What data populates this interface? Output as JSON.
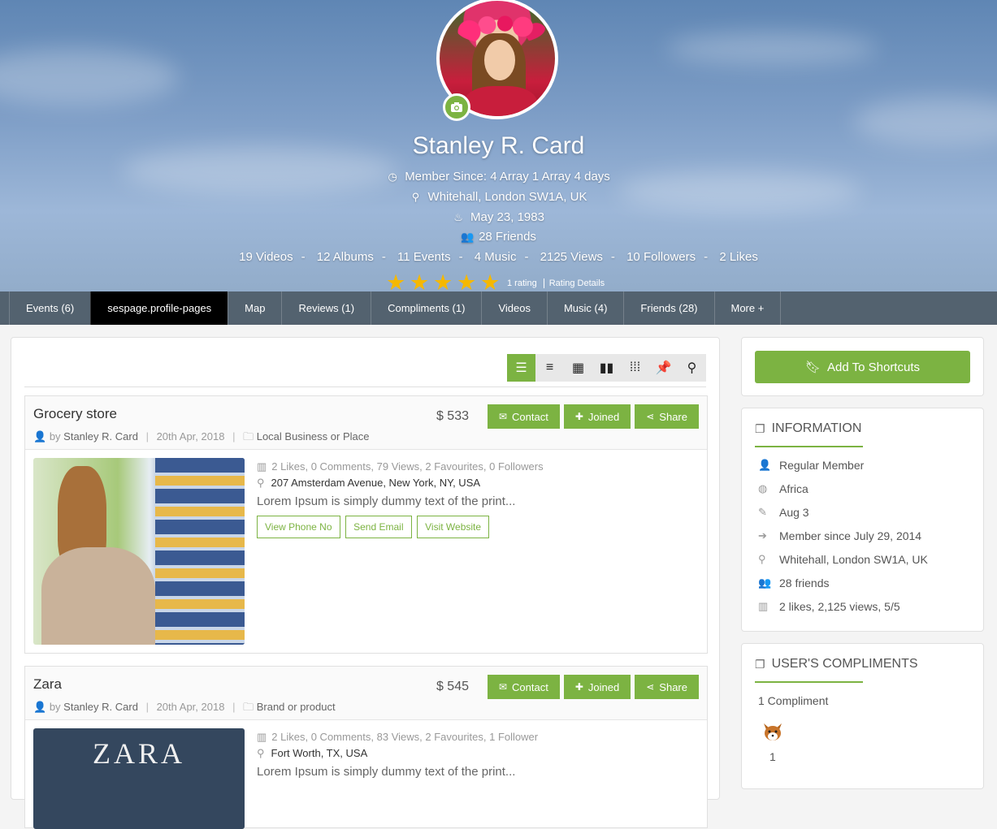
{
  "profile": {
    "name": "Stanley R. Card",
    "member_since": "Member Since: 4 Array 1 Array 4 days",
    "location": "Whitehall, London SW1A, UK",
    "birthday": "May 23, 1983",
    "friends": "28 Friends",
    "stats": [
      "19 Videos",
      "12 Albums",
      "11 Events",
      "4 Music",
      "2125 Views",
      "10 Followers",
      "2 Likes"
    ],
    "stats_separator": "-",
    "rating_value": 5,
    "rating_max": 5,
    "rating_count": "1 rating",
    "rating_details": "Rating Details"
  },
  "tabs": [
    {
      "label": "Events (6)",
      "active": false
    },
    {
      "label": "sespage.profile-pages",
      "active": true
    },
    {
      "label": "Map",
      "active": false
    },
    {
      "label": "Reviews (1)",
      "active": false
    },
    {
      "label": "Compliments (1)",
      "active": false
    },
    {
      "label": "Videos",
      "active": false
    },
    {
      "label": "Music (4)",
      "active": false
    },
    {
      "label": "Friends (28)",
      "active": false
    },
    {
      "label": "More +",
      "active": false
    }
  ],
  "view_modes": [
    "list-view-icon",
    "simple-list-icon",
    "grid-icon",
    "pinboard-icon",
    "small-grid-icon",
    "pin-icon",
    "map-marker-icon"
  ],
  "pages": [
    {
      "title": "Grocery store",
      "by": "by",
      "owner": "Stanley R. Card",
      "date": "20th Apr, 2018",
      "category": "Local Business or Place",
      "price": "$ 533",
      "buttons": {
        "contact": "Contact",
        "joined": "Joined",
        "share": "Share"
      },
      "stats": "2 Likes, 0 Comments, 79 Views, 2 Favourites, 0 Followers",
      "address": "207 Amsterdam Avenue, New York, NY, USA",
      "description": "Lorem Ipsum is simply dummy text of the print...",
      "actions": {
        "phone": "View Phone No",
        "email": "Send Email",
        "website": "Visit Website"
      }
    },
    {
      "title": "Zara",
      "by": "by",
      "owner": "Stanley R. Card",
      "date": "20th Apr, 2018",
      "category": "Brand or product",
      "price": "$ 545",
      "buttons": {
        "contact": "Contact",
        "joined": "Joined",
        "share": "Share"
      },
      "stats": "2 Likes, 0 Comments, 83 Views, 2 Favourites, 1 Follower",
      "address": "Fort Worth, TX, USA",
      "description": "Lorem Ipsum is simply dummy text of the print...",
      "logo_text": "ZARA"
    }
  ],
  "sidebar": {
    "shortcut_label": "Add To Shortcuts",
    "information": {
      "title": "INFORMATION",
      "rows": [
        {
          "icon": "user-icon",
          "text": "Regular Member"
        },
        {
          "icon": "globe-icon",
          "text": "Africa"
        },
        {
          "icon": "pencil-icon",
          "text": "Aug 3"
        },
        {
          "icon": "sign-in-icon",
          "text": "Member since July 29, 2014"
        },
        {
          "icon": "map-marker-icon",
          "text": "Whitehall, London SW1A, UK"
        },
        {
          "icon": "users-icon",
          "text": "28 friends"
        },
        {
          "icon": "bar-chart-icon",
          "text": "2 likes, 2,125 views, 5/5"
        }
      ]
    },
    "compliments": {
      "title": "USER'S COMPLIMENTS",
      "count_text": "1 Compliment",
      "badge_count": "1"
    }
  },
  "colors": {
    "accent": "#7cb342",
    "star": "#f5b800",
    "tab_active": "#000000"
  }
}
